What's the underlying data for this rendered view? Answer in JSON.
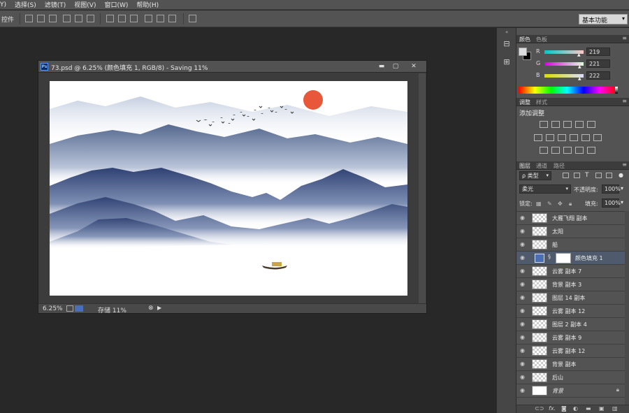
{
  "menubar": {
    "items": [
      "Y)",
      "选择(S)",
      "滤镜(T)",
      "视图(V)",
      "窗口(W)",
      "帮助(H)"
    ]
  },
  "options": {
    "label": "控件",
    "workspace": "基本功能"
  },
  "document": {
    "title": "73.psd @ 6.25% (颜色填充 1, RGB/8) - Saving 11%",
    "zoom": "6.25%",
    "status": "存储 11%",
    "window_buttons": [
      "▬",
      "▢",
      "✕"
    ]
  },
  "color_panel": {
    "tabs": [
      "颜色",
      "色板"
    ],
    "channels": [
      {
        "label": "R",
        "value": "219",
        "start": "#00c8c8",
        "end": "#ffc8c8",
        "fraction": 0.86
      },
      {
        "label": "G",
        "value": "221",
        "start": "#dc00dc",
        "end": "#dcffdc",
        "fraction": 0.87
      },
      {
        "label": "B",
        "value": "222",
        "start": "#dbdd00",
        "end": "#dbddff",
        "fraction": 0.87
      }
    ],
    "foreground": "#dbddde",
    "background": "#000000"
  },
  "adjust_panel": {
    "tabs": [
      "调整",
      "样式"
    ],
    "title": "添加调整"
  },
  "layers_panel": {
    "tabs": [
      "图层",
      "通道",
      "路径"
    ],
    "filter_type": "ρ 类型",
    "blend_mode": "柔光",
    "opacity_label": "不透明度:",
    "opacity": "100%",
    "lock_label": "锁定:",
    "fill_label": "填充:",
    "fill": "100%",
    "layers": [
      {
        "name": "大雁飞翔 副本",
        "selected": false
      },
      {
        "name": "太阳",
        "selected": false
      },
      {
        "name": "船",
        "selected": false
      },
      {
        "name": "颜色填充 1",
        "selected": true
      },
      {
        "name": "云雾 副本 7",
        "selected": false
      },
      {
        "name": "背景 副本 3",
        "selected": false
      },
      {
        "name": "图层 14 副本",
        "selected": false
      },
      {
        "name": "云雾 副本 12",
        "selected": false
      },
      {
        "name": "图层 2 副本 4",
        "selected": false
      },
      {
        "name": "云雾 副本 9",
        "selected": false
      },
      {
        "name": "云雾 副本 12",
        "selected": false
      },
      {
        "name": "背景 副本",
        "selected": false
      },
      {
        "name": "后山",
        "selected": false
      },
      {
        "name": "背景",
        "selected": false
      }
    ],
    "footer_icons": [
      "link-icon",
      "fx-icon",
      "mask-icon",
      "adjustment-icon",
      "folder-icon",
      "new-layer-icon",
      "trash-icon"
    ]
  },
  "colors": {
    "sun": "#e8573a",
    "mountain_dark": "#3a4d7a",
    "mountain_mid": "#6679a3",
    "mountain_light": "#a9b6cf",
    "fill_swatch": "#4a6fb5"
  }
}
